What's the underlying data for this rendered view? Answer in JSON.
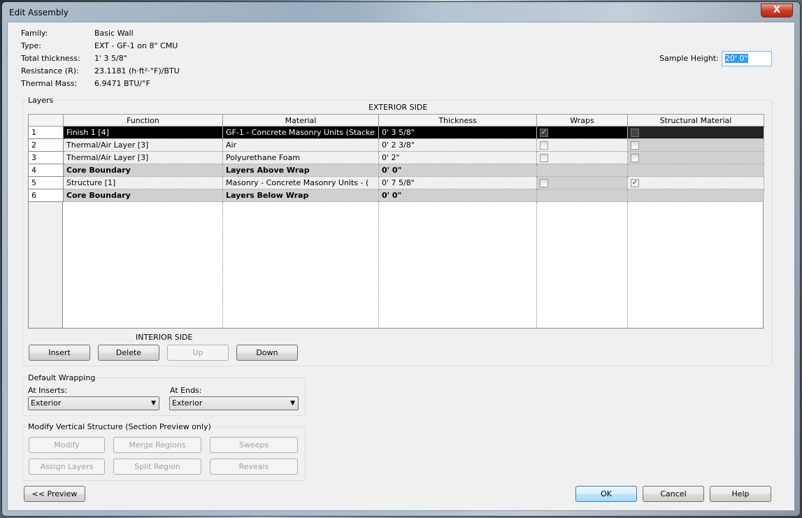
{
  "window": {
    "title": "Edit Assembly",
    "close": "X"
  },
  "info": [
    {
      "label": "Family:",
      "value": "Basic Wall"
    },
    {
      "label": "Type:",
      "value": "EXT - GF-1 on 8\" CMU"
    },
    {
      "label": "Total thickness:",
      "value": "1'  3 5/8\""
    },
    {
      "label": "Resistance (R):",
      "value": "23.1181 (h·ft²·°F)/BTU"
    },
    {
      "label": "Thermal Mass:",
      "value": "6.9471 BTU/°F"
    }
  ],
  "sample_height": {
    "label": "Sample Height:",
    "value": "20'  0\""
  },
  "layers": {
    "group_label": "Layers",
    "exterior": "EXTERIOR SIDE",
    "interior": "INTERIOR SIDE",
    "columns": [
      "Function",
      "Material",
      "Thickness",
      "Wraps",
      "Structural Material"
    ],
    "rows": [
      {
        "n": "1",
        "function": "Finish 1 [4]",
        "material": "GF-1 - Concrete Masonry Units (Stacke",
        "thickness": "0'  3 5/8\"",
        "wraps": true,
        "structural": false
      },
      {
        "n": "2",
        "function": "Thermal/Air Layer [3]",
        "material": "Air",
        "thickness": "0'  2 3/8\"",
        "wraps": false,
        "structural": false
      },
      {
        "n": "3",
        "function": "Thermal/Air Layer [3]",
        "material": "Polyurethane Foam",
        "thickness": "0'  2\"",
        "wraps": false,
        "structural": false
      },
      {
        "n": "4",
        "function": "Core Boundary",
        "material": "Layers Above Wrap",
        "thickness": "0'  0\""
      },
      {
        "n": "5",
        "function": "Structure [1]",
        "material": "Masonry - Concrete Masonry Units - (",
        "thickness": "0'  7 5/8\"",
        "wraps": false,
        "structural": true
      },
      {
        "n": "6",
        "function": "Core Boundary",
        "material": "Layers Below Wrap",
        "thickness": "0'  0\""
      }
    ],
    "buttons": {
      "insert": "Insert",
      "delete": "Delete",
      "up": "Up",
      "down": "Down"
    }
  },
  "wrapping": {
    "group_label": "Default Wrapping",
    "inserts_label": "At Inserts:",
    "inserts_value": "Exterior",
    "ends_label": "At  Ends:",
    "ends_value": "Exterior"
  },
  "vertical": {
    "group_label": "Modify Vertical Structure (Section Preview only)",
    "modify": "Modify",
    "merge": "Merge Regions",
    "sweeps": "Sweeps",
    "assign": "Assign Layers",
    "split": "Split Region",
    "reveals": "Reveals"
  },
  "footer": {
    "preview": "<< Preview",
    "ok": "OK",
    "cancel": "Cancel",
    "help": "Help"
  }
}
